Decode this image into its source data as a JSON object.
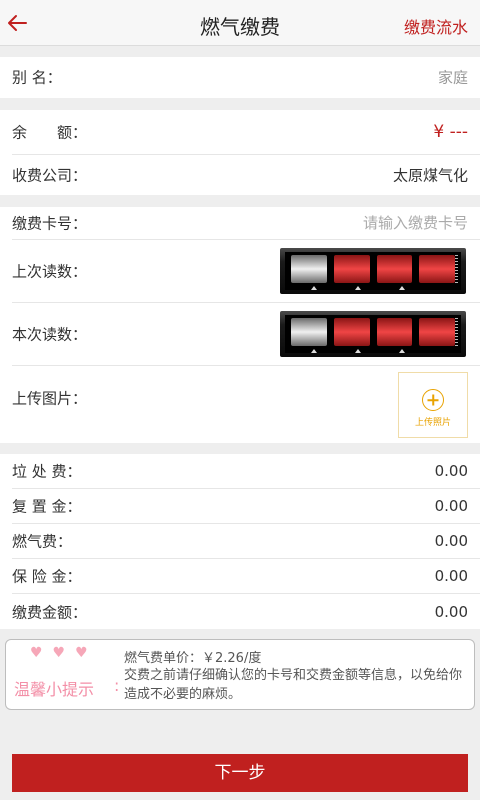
{
  "header": {
    "title": "燃气缴费",
    "record_link": "缴费流水"
  },
  "alias": {
    "label": "别 名：",
    "value": "家庭"
  },
  "account": {
    "balance_label": "余　　额：",
    "balance_value": "¥ ---",
    "company_label": "收费公司：",
    "company_value": "太原煤气化"
  },
  "reading": {
    "card_label": "缴费卡号：",
    "card_placeholder": "请输入缴费卡号",
    "last_label": "上次读数：",
    "current_label": "本次读数：",
    "upload_label": "上传图片：",
    "upload_button": "上传照片"
  },
  "fees": [
    {
      "label": "垃 处 费：",
      "value": "0.00"
    },
    {
      "label": "复 置 金：",
      "value": "0.00"
    },
    {
      "label": "燃气费：",
      "value": "0.00"
    },
    {
      "label": "保 险 金：",
      "value": "0.00"
    },
    {
      "label": "缴费金额：",
      "value": "0.00"
    }
  ],
  "tip": {
    "hearts": "♥♥♥",
    "title": "温馨小提示",
    "colon": ":",
    "price_line": "燃气费单价：￥2.26/度",
    "notice": "交费之前请仔细确认您的卡号和交费金额等信息，以免给你造成不必要的麻烦。"
  },
  "next_button": "下一步",
  "colors": {
    "accent": "#c0201f",
    "tip_pink": "#f38fa7",
    "upload_orange": "#e8a200"
  }
}
